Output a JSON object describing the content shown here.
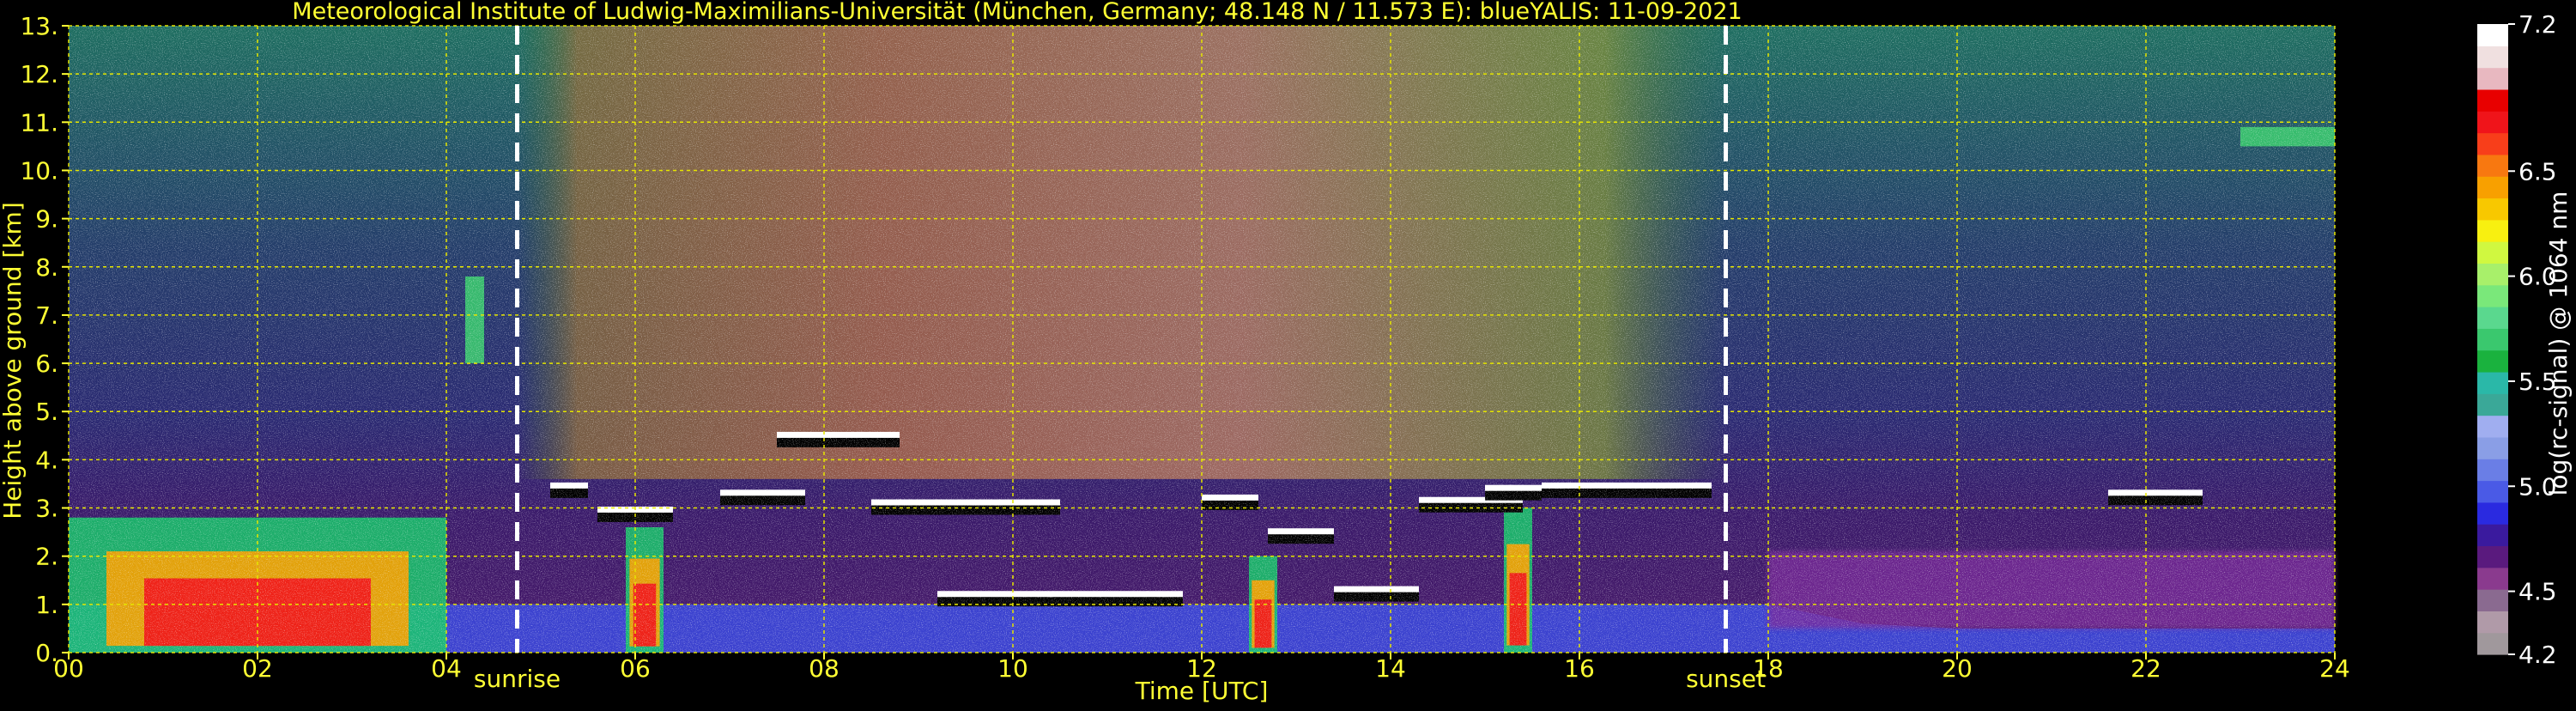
{
  "chart_data": {
    "type": "heatmap",
    "title": "Meteorological Institute of Ludwig-Maximilians-Universität (München, Germany; 48.148 N / 11.573 E):    blueYALIS: 11-09-2021",
    "xlabel": "Time [UTC]",
    "ylabel": "Height above ground [km]",
    "colorbar_label": "log(rc-signal) @ 1064 nm",
    "xlim": [
      0,
      24
    ],
    "ylim": [
      0,
      13
    ],
    "x_ticks": [
      "00",
      "02",
      "04",
      "06",
      "08",
      "10",
      "12",
      "14",
      "16",
      "18",
      "20",
      "22",
      "24"
    ],
    "y_ticks": [
      "0.",
      "1.",
      "2.",
      "3.",
      "4.",
      "5.",
      "6.",
      "7.",
      "8.",
      "9.",
      "10.",
      "11.",
      "12.",
      "13."
    ],
    "colorbar_ticks": [
      "4.2",
      "4.5",
      "5.0",
      "5.5",
      "6.0",
      "6.5",
      "7.2"
    ],
    "colorbar_range": [
      4.2,
      7.2
    ],
    "grid": true,
    "markers": [
      {
        "label": "sunrise",
        "x": 4.75
      },
      {
        "label": "sunset",
        "x": 17.55
      }
    ],
    "colors": {
      "text": "#ffff33",
      "grid": "#e6e600",
      "colorbar_label": "#ffffff",
      "colorbar": [
        "#a0989c",
        "#b09aa8",
        "#8a6a90",
        "#8a3a8e",
        "#5a1a7e",
        "#3a1a9e",
        "#2a2ae0",
        "#4a5ae6",
        "#6a7ee6",
        "#8a9ee6",
        "#a0aef0",
        "#3aa898",
        "#2ab8a8",
        "#1ab23e",
        "#3ac86e",
        "#5ad88e",
        "#7ae87a",
        "#a8f06a",
        "#d0f840",
        "#f8f010",
        "#f8c800",
        "#f8a000",
        "#f87810",
        "#f83e1a",
        "#f0141a",
        "#e80000",
        "#e8b8c0",
        "#f0e0e0",
        "#ffffff"
      ]
    },
    "signal_field": {
      "description_free": true,
      "hours": [
        0,
        1,
        2,
        3,
        4,
        5,
        6,
        7,
        8,
        9,
        10,
        11,
        12,
        13,
        14,
        15,
        16,
        17,
        18,
        19,
        20,
        21,
        22,
        23,
        24
      ],
      "boundary_layer_top_km": [
        2.8,
        2.9,
        2.9,
        3.0,
        1.5,
        1.3,
        2.2,
        3.0,
        3.1,
        2.9,
        2.8,
        2.8,
        2.7,
        2.8,
        3.0,
        3.2,
        3.2,
        3.2,
        1.0,
        0.6,
        0.5,
        0.5,
        0.5,
        0.5,
        0.5
      ],
      "cloud_layers": [
        {
          "start": 5.1,
          "end": 5.5,
          "height": 3.35
        },
        {
          "start": 5.6,
          "end": 6.4,
          "height": 2.85
        },
        {
          "start": 6.9,
          "end": 7.8,
          "height": 3.2
        },
        {
          "start": 7.5,
          "end": 8.8,
          "height": 4.4
        },
        {
          "start": 8.5,
          "end": 10.5,
          "height": 3.0
        },
        {
          "start": 9.2,
          "end": 11.8,
          "height": 1.1
        },
        {
          "start": 12.0,
          "end": 12.6,
          "height": 3.1
        },
        {
          "start": 12.7,
          "end": 13.4,
          "height": 2.4
        },
        {
          "start": 13.4,
          "end": 14.3,
          "height": 1.2
        },
        {
          "start": 14.3,
          "end": 15.4,
          "height": 3.05
        },
        {
          "start": 15.0,
          "end": 15.6,
          "height": 3.3
        },
        {
          "start": 15.6,
          "end": 17.4,
          "height": 3.35
        },
        {
          "start": 21.6,
          "end": 22.6,
          "height": 3.2
        }
      ],
      "elevated_layers": [
        {
          "start": 4.2,
          "end": 4.4,
          "bottom": 6.0,
          "top": 7.8
        },
        {
          "start": 23.0,
          "end": 24.0,
          "bottom": 10.5,
          "top": 10.9
        }
      ],
      "convective_plumes": [
        {
          "start": 0.0,
          "end": 4.0,
          "top": 2.8
        },
        {
          "start": 5.9,
          "end": 6.3,
          "top": 2.6
        },
        {
          "start": 12.5,
          "end": 12.8,
          "top": 2.0
        },
        {
          "start": 15.2,
          "end": 15.5,
          "top": 3.0
        }
      ]
    }
  }
}
